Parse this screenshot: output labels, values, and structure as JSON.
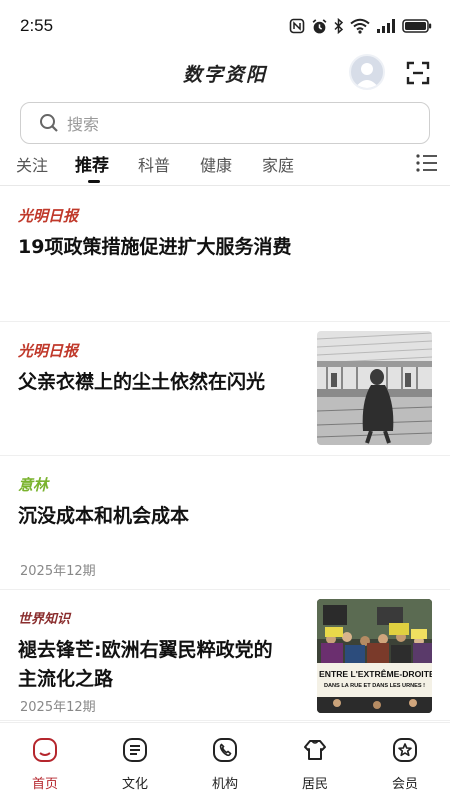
{
  "status_bar": {
    "time": "2:55",
    "icons": [
      "nfc-icon",
      "alarm-icon",
      "bluetooth-icon",
      "wifi-icon",
      "signal-icon",
      "battery-icon"
    ]
  },
  "header": {
    "title": "数字资阳",
    "avatar": "avatar-icon",
    "scan": "scan-icon"
  },
  "search": {
    "placeholder": "搜索"
  },
  "tabs": [
    {
      "label": "关注",
      "active": false
    },
    {
      "label": "推荐",
      "active": true
    },
    {
      "label": "科普",
      "active": false
    },
    {
      "label": "健康",
      "active": false
    },
    {
      "label": "家庭",
      "active": false
    }
  ],
  "feed": [
    {
      "source": "光明日报",
      "source_color": "#c0392b",
      "title": "19项政策措施促进扩大服务消费",
      "meta": ""
    },
    {
      "source": "光明日报",
      "source_color": "#c0392b",
      "title": "父亲衣襟上的尘土依然在闪光",
      "meta": ""
    },
    {
      "source": "意林",
      "source_color": "#7ab32e",
      "title": "沉没成本和机会成本",
      "meta": "2025年12期"
    },
    {
      "source": "世界知识",
      "source_color": "#8a2d2d",
      "title_line1": "褪去锋芒:欧洲右翼民粹政党的",
      "title_line2": "主流化之路",
      "meta": "2025年12期",
      "banner_line1": "ENTRE L'EXTRÊME-DROITE",
      "banner_line2": "DANS LA RUE ET DANS LES URNES !"
    }
  ],
  "tabbar": [
    {
      "label": "首页",
      "active": true,
      "icon": "home-icon"
    },
    {
      "label": "文化",
      "active": false,
      "icon": "culture-icon"
    },
    {
      "label": "机构",
      "active": false,
      "icon": "institution-icon"
    },
    {
      "label": "居民",
      "active": false,
      "icon": "residents-icon"
    },
    {
      "label": "会员",
      "active": false,
      "icon": "member-icon"
    }
  ],
  "colors": {
    "accent": "#b5262d",
    "text": "#111111",
    "muted": "#888888"
  }
}
